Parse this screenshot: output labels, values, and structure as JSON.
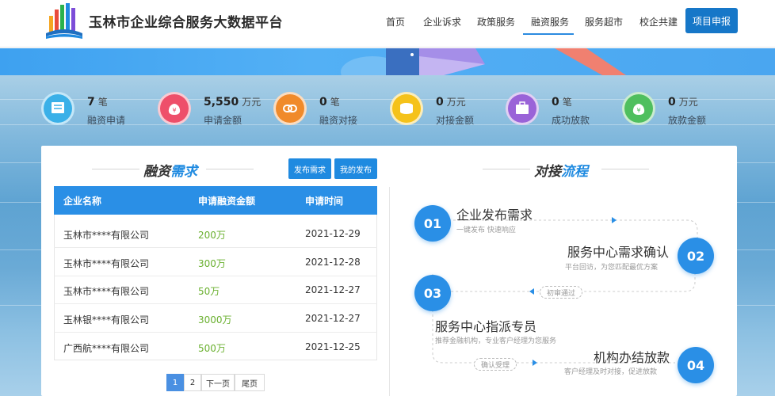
{
  "header": {
    "site_title": "玉林市企业综合服务大数据平台",
    "nav": [
      "首页",
      "企业诉求",
      "政策服务",
      "融资服务",
      "服务超市",
      "校企共建"
    ],
    "active_nav": "融资服务",
    "apply_button": "项目申报"
  },
  "colors": {
    "primary": "#1f8ae0",
    "amount": "#6ab02f",
    "header_btn": "#1677c8"
  },
  "stats": [
    {
      "icon": "document-icon",
      "color": "#3ab0e8",
      "value": "7",
      "unit": "笔",
      "label": "融资申请"
    },
    {
      "icon": "money-bag-icon",
      "color": "#ee4f6a",
      "value": "5,550",
      "unit": "万元",
      "label": "申请金额"
    },
    {
      "icon": "link-icon",
      "color": "#f08a2a",
      "value": "0",
      "unit": "笔",
      "label": "融资对接"
    },
    {
      "icon": "coins-icon",
      "color": "#f5c21a",
      "value": "0",
      "unit": "万元",
      "label": "对接金额"
    },
    {
      "icon": "briefcase-icon",
      "color": "#9a63d8",
      "value": "0",
      "unit": "笔",
      "label": "成功放款"
    },
    {
      "icon": "money-bag-icon",
      "color": "#4fbf5e",
      "value": "0",
      "unit": "万元",
      "label": "放款金额"
    }
  ],
  "demand": {
    "title_a": "融资",
    "title_b": "需求",
    "publish_button": "发布需求",
    "my_publish_button": "我的发布",
    "columns": [
      "企业名称",
      "申请融资金额",
      "申请时间"
    ],
    "rows": [
      {
        "company": "玉林市****有限公司",
        "amount": "200万",
        "date": "2021-12-29"
      },
      {
        "company": "玉林市****有限公司",
        "amount": "300万",
        "date": "2021-12-28"
      },
      {
        "company": "玉林市****有限公司",
        "amount": "50万",
        "date": "2021-12-27"
      },
      {
        "company": "玉林银****有限公司",
        "amount": "3000万",
        "date": "2021-12-27"
      },
      {
        "company": "广西航****有限公司",
        "amount": "500万",
        "date": "2021-12-25"
      }
    ],
    "pagination": {
      "pages": [
        "1",
        "2"
      ],
      "current": "1",
      "next": "下一页",
      "last": "尾页"
    }
  },
  "flow": {
    "title_a": "对接",
    "title_b": "流程",
    "steps": [
      {
        "num": "01",
        "title": "企业发布需求",
        "desc": "一键发布 快速响应"
      },
      {
        "num": "02",
        "title": "服务中心需求确认",
        "desc": "平台回访，为您匹配最优方案"
      },
      {
        "num": "03",
        "title": "服务中心指派专员",
        "desc": "推荐金融机构，专业客户经理为您服务"
      },
      {
        "num": "04",
        "title": "机构办结放款",
        "desc": "客户经理及时对接，促进放款"
      }
    ],
    "tags": [
      "初审通过",
      "确认受理"
    ]
  }
}
